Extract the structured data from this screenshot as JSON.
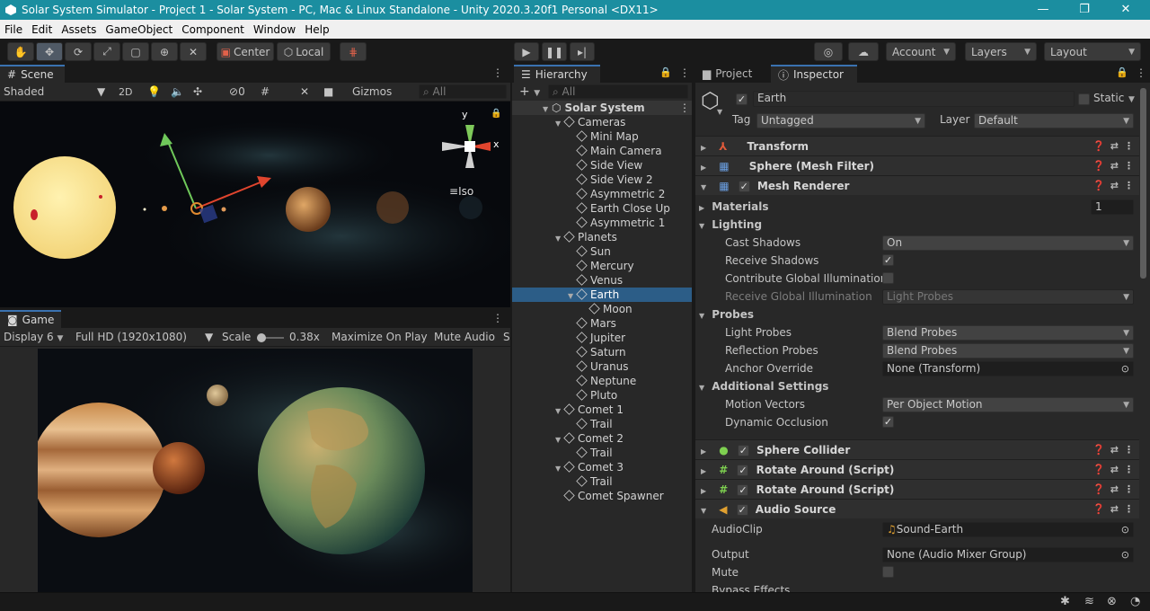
{
  "window": {
    "title": "Solar System Simulator - Project 1 - Solar System - PC, Mac & Linux Standalone - Unity 2020.3.20f1 Personal <DX11>",
    "minimize": "—",
    "maximize": "❐",
    "close": "✕"
  },
  "menu": [
    "File",
    "Edit",
    "Assets",
    "GameObject",
    "Component",
    "Window",
    "Help"
  ],
  "toolbar": {
    "pivot_label": "Center",
    "space_label": "Local",
    "account_label": "Account",
    "layers_label": "Layers",
    "layout_label": "Layout"
  },
  "scene": {
    "tab_label": "Scene",
    "shading": "Shaded",
    "mode_2d": "2D",
    "hidden_count": "0",
    "gizmos": "Gizmos",
    "search_placeholder": "All",
    "gizmo_y": "y",
    "gizmo_x": "x",
    "projection": "Iso"
  },
  "game": {
    "tab_label": "Game",
    "display": "Display 6",
    "resolution": "Full HD (1920x1080)",
    "scale_label": "Scale",
    "scale_value": "0.38x",
    "maximize_on_play": "Maximize On Play",
    "mute_audio": "Mute Audio",
    "stats_cut": "S"
  },
  "hierarchy": {
    "tab_label": "Hierarchy",
    "search_placeholder": "All",
    "scene_name": "Solar System",
    "items": [
      {
        "label": "Cameras",
        "depth": 1,
        "expanded": true
      },
      {
        "label": "Mini Map",
        "depth": 2
      },
      {
        "label": "Main Camera",
        "depth": 2
      },
      {
        "label": "Side View",
        "depth": 2
      },
      {
        "label": "Side View 2",
        "depth": 2
      },
      {
        "label": "Asymmetric 2",
        "depth": 2
      },
      {
        "label": "Earth Close Up",
        "depth": 2
      },
      {
        "label": "Asymmetric 1",
        "depth": 2
      },
      {
        "label": "Planets",
        "depth": 1,
        "expanded": true
      },
      {
        "label": "Sun",
        "depth": 2
      },
      {
        "label": "Mercury",
        "depth": 2
      },
      {
        "label": "Venus",
        "depth": 2
      },
      {
        "label": "Earth",
        "depth": 2,
        "expanded": true,
        "selected": true
      },
      {
        "label": "Moon",
        "depth": 3
      },
      {
        "label": "Mars",
        "depth": 2
      },
      {
        "label": "Jupiter",
        "depth": 2
      },
      {
        "label": "Saturn",
        "depth": 2
      },
      {
        "label": "Uranus",
        "depth": 2
      },
      {
        "label": "Neptune",
        "depth": 2
      },
      {
        "label": "Pluto",
        "depth": 2
      },
      {
        "label": "Comet 1",
        "depth": 1,
        "expanded": true
      },
      {
        "label": "Trail",
        "depth": 2
      },
      {
        "label": "Comet 2",
        "depth": 1,
        "expanded": true
      },
      {
        "label": "Trail",
        "depth": 2
      },
      {
        "label": "Comet 3",
        "depth": 1,
        "expanded": true
      },
      {
        "label": "Trail",
        "depth": 2
      },
      {
        "label": "Comet Spawner",
        "depth": 1
      }
    ]
  },
  "inspector": {
    "project_tab": "Project",
    "inspector_tab": "Inspector",
    "object_name": "Earth",
    "static_label": "Static",
    "tag_label": "Tag",
    "tag_value": "Untagged",
    "layer_label": "Layer",
    "layer_value": "Default",
    "components": {
      "transform": "Transform",
      "mesh_filter": "Sphere (Mesh Filter)",
      "mesh_renderer": "Mesh Renderer",
      "sphere_collider": "Sphere Collider",
      "rotate_1": "Rotate Around (Script)",
      "rotate_2": "Rotate Around (Script)",
      "audio_source": "Audio Source"
    },
    "materials_label": "Materials",
    "materials_count": "1",
    "lighting_label": "Lighting",
    "cast_shadows_label": "Cast Shadows",
    "cast_shadows_value": "On",
    "receive_shadows_label": "Receive Shadows",
    "contribute_gi_label": "Contribute Global Illumination",
    "receive_gi_label": "Receive Global Illumination",
    "receive_gi_value": "Light Probes",
    "probes_label": "Probes",
    "light_probes_label": "Light Probes",
    "light_probes_value": "Blend Probes",
    "reflection_probes_label": "Reflection Probes",
    "reflection_probes_value": "Blend Probes",
    "anchor_override_label": "Anchor Override",
    "anchor_override_value": "None (Transform)",
    "additional_label": "Additional Settings",
    "motion_vectors_label": "Motion Vectors",
    "motion_vectors_value": "Per Object Motion",
    "dynamic_occlusion_label": "Dynamic Occlusion",
    "audioclip_label": "AudioClip",
    "audioclip_value": "Sound-Earth",
    "output_label": "Output",
    "output_value": "None (Audio Mixer Group)",
    "mute_label": "Mute",
    "bypass_label": "Bypass Effects"
  },
  "colors": {
    "titlebar": "#1b8ea0",
    "selection": "#2c5d87",
    "panel": "#282828"
  }
}
